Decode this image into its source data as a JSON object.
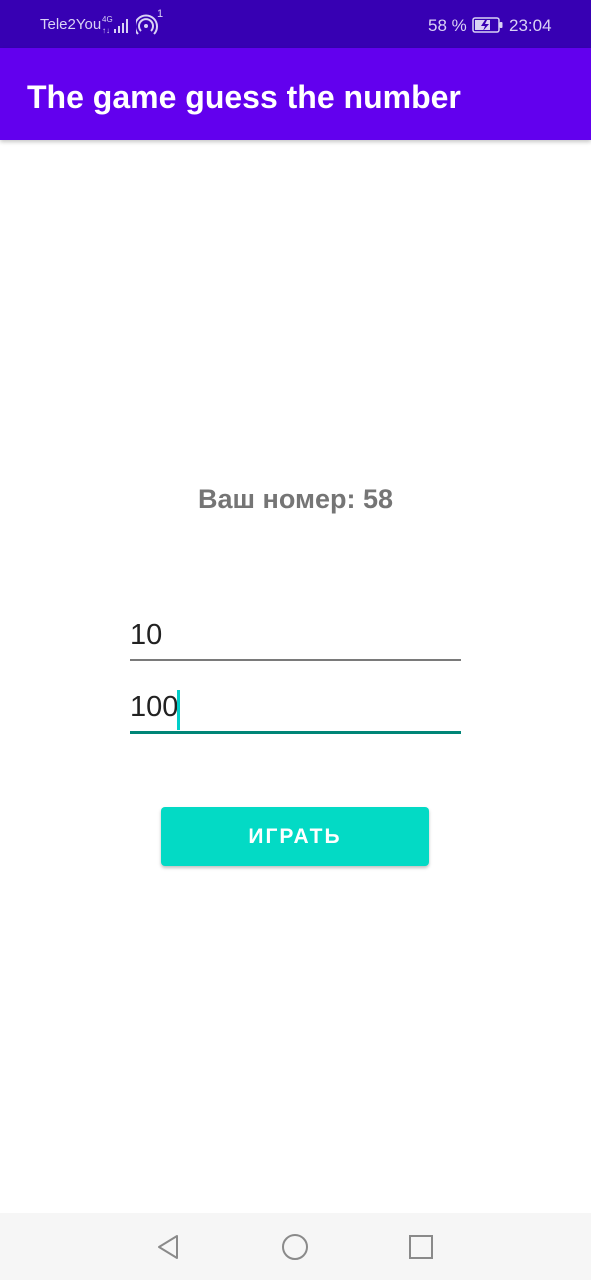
{
  "status_bar": {
    "carrier": "Tele2You",
    "network_type": "4G",
    "hotspot_count": "1",
    "battery_percent": "58 %",
    "time": "23:04",
    "icons": [
      "signal-icon",
      "hotspot-icon",
      "battery-charging-icon"
    ]
  },
  "app_bar": {
    "title": "The game guess the number",
    "color": "#6200ee"
  },
  "main": {
    "result_text": "Ваш номер: 58",
    "min_field": {
      "value": "10"
    },
    "max_field": {
      "value": "100"
    },
    "play_button_label": "ИГРАТЬ",
    "accent_color": "#03dac5"
  },
  "nav_bar": {
    "icons": [
      "back-icon",
      "home-icon",
      "recent-apps-icon"
    ]
  }
}
